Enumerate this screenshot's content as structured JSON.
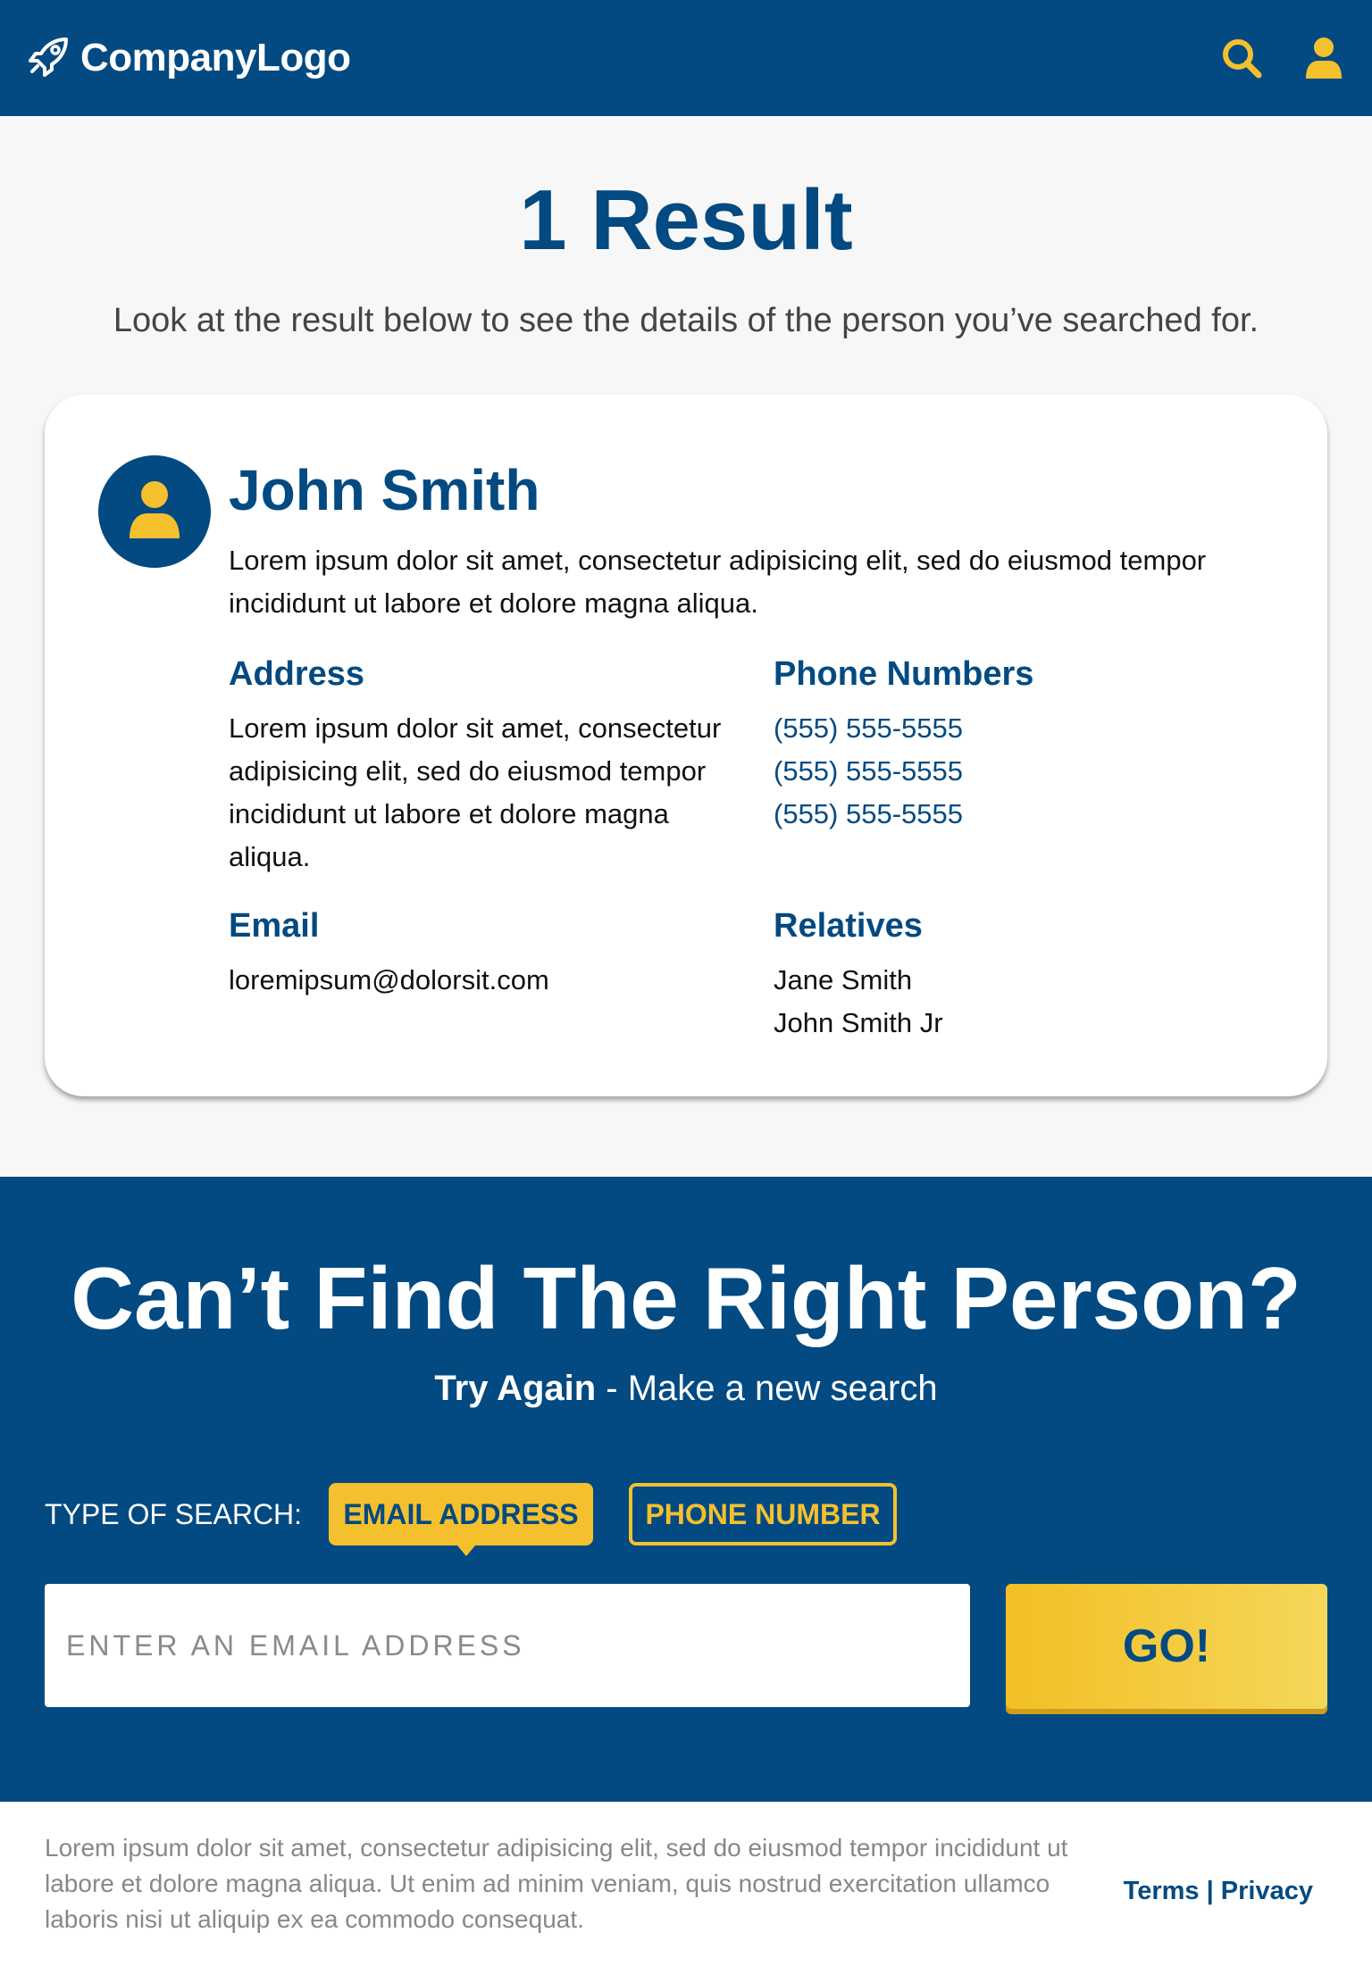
{
  "header": {
    "logo_text": "CompanyLogo",
    "icons": [
      "rocket-icon",
      "search-icon",
      "user-icon"
    ],
    "accent_color": "#f5c02e",
    "bg_color": "#024a81"
  },
  "results": {
    "title": "1 Result",
    "subtitle": "Look at the result below to see the details of the person you’ve searched for."
  },
  "person": {
    "name": "John Smith",
    "description": "Lorem ipsum dolor sit amet, consectetur adipisicing elit, sed do eiusmod tempor incididunt ut labore et dolore magna aliqua.",
    "address_title": "Address",
    "address": "Lorem ipsum dolor sit amet, consectetur adipisicing elit, sed do eiusmod tempor incididunt ut labore et dolore magna aliqua.",
    "phones_title": "Phone Numbers",
    "phones": [
      "(555) 555-5555",
      "(555) 555-5555",
      "(555) 555-5555"
    ],
    "email_title": "Email",
    "email": "loremipsum@dolorsit.com",
    "relatives_title": "Relatives",
    "relatives": [
      "Jane Smith",
      "John Smith Jr"
    ]
  },
  "search": {
    "title": "Can’t Find The Right Person?",
    "sub_bold": "Try Again",
    "sub_rest": " - Make a new search",
    "type_label": "TYPE OF SEARCH:",
    "type_email": "EMAIL ADDRESS",
    "type_phone": "PHONE NUMBER",
    "input_placeholder": "ENTER AN EMAIL ADDRESS",
    "input_value": "",
    "go_label": "GO!"
  },
  "footer": {
    "text": "Lorem ipsum dolor sit amet, consectetur adipisicing elit, sed do eiusmod tempor incididunt ut labore et dolore magna aliqua. Ut enim ad minim veniam, quis nostrud exercitation ullamco laboris nisi ut aliquip ex ea commodo consequat.",
    "terms": "Terms",
    "separator": "|",
    "privacy": "Privacy"
  }
}
